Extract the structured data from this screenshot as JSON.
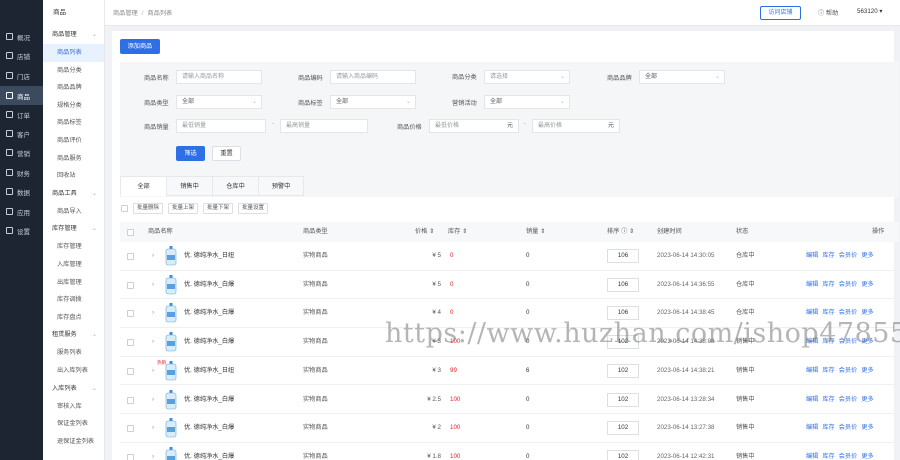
{
  "brand": "",
  "rail": [
    {
      "label": "概况",
      "icon": "overview-icon"
    },
    {
      "label": "店铺",
      "icon": "store-icon"
    },
    {
      "label": "门店",
      "icon": "shop-front-icon"
    },
    {
      "label": "商品",
      "icon": "goods-icon",
      "active": true
    },
    {
      "label": "订单",
      "icon": "order-icon"
    },
    {
      "label": "客户",
      "icon": "customer-icon"
    },
    {
      "label": "营销",
      "icon": "marketing-icon"
    },
    {
      "label": "财务",
      "icon": "finance-icon"
    },
    {
      "label": "数据",
      "icon": "data-icon"
    },
    {
      "label": "应用",
      "icon": "app-icon"
    },
    {
      "label": "设置",
      "icon": "settings-icon"
    }
  ],
  "submenu": {
    "title": "商品",
    "groups": [
      {
        "label": "商品管理",
        "items": [
          "商品列表",
          "商品分类",
          "商品品牌",
          "规格分类",
          "商品标签",
          "商品评价",
          "商品服务",
          "回收站"
        ]
      },
      {
        "label": "商品工具",
        "items": [
          "商品导入"
        ]
      },
      {
        "label": "库存管理",
        "items": [
          "库存管理",
          "入库管理",
          "出库管理",
          "库存调拨",
          "库存盘点"
        ]
      },
      {
        "label": "租赁服务",
        "items": [
          "服务列表",
          "出入库列表"
        ]
      },
      {
        "label": "入库列表",
        "items": [
          "审核入库",
          "保证金列表",
          "退保证金列表"
        ]
      }
    ],
    "active_item": "商品列表"
  },
  "topbar": {
    "breadcrumb": [
      "商品管理",
      "商品列表"
    ],
    "visit_store": "访问店铺",
    "help": "帮助",
    "user": "563120"
  },
  "add_button": "添加商品",
  "filters": {
    "name_label": "商品名称",
    "name_placeholder": "请输入商品名称",
    "code_label": "商品编码",
    "code_placeholder": "请输入商品编码",
    "category_label": "商品分类",
    "category_placeholder": "请选择",
    "brand_label": "商品品牌",
    "brand_value": "全部",
    "type_label": "商品类型",
    "type_value": "全部",
    "tag_label": "商品标签",
    "tag_value": "全部",
    "promo_label": "营销活动",
    "promo_value": "全部",
    "sales_label": "商品销量",
    "sales_min": "最低销量",
    "sales_max": "最高销量",
    "price_label": "商品价格",
    "price_min": "最低价格",
    "price_max": "最高价格",
    "unit": "元",
    "search": "筛选",
    "reset": "重置"
  },
  "tabs": [
    "全部",
    "销售中",
    "仓库中",
    "预警中"
  ],
  "active_tab": "全部",
  "batch_actions": [
    "批量删除",
    "批量上架",
    "批量下架",
    "批量设置"
  ],
  "columns": {
    "name": "商品名称",
    "type": "商品类型",
    "price": "价格",
    "stock": "库存",
    "sales": "销量",
    "sort": "排序",
    "created": "创建时间",
    "status": "状态",
    "ops": "操作"
  },
  "row_actions": [
    "编辑",
    "库存",
    "会员价",
    "更多"
  ],
  "rows": [
    {
      "name": "优. 德纯净水_日纽",
      "type": "实物商品",
      "price": "¥ 5",
      "stock": "0",
      "sales": "0",
      "sort": "106",
      "created": "2023-06-14 14:30:05",
      "status": "仓库中",
      "badge": ""
    },
    {
      "name": "优. 德纯净水_白爆",
      "type": "实物商品",
      "price": "¥ 5",
      "stock": "0",
      "sales": "0",
      "sort": "106",
      "created": "2023-06-14 14:36:55",
      "status": "仓库中",
      "badge": ""
    },
    {
      "name": "优. 德纯净水_白爆",
      "type": "实物商品",
      "price": "¥ 4",
      "stock": "0",
      "sales": "0",
      "sort": "106",
      "created": "2023-06-14 14:38:45",
      "status": "仓库中",
      "badge": ""
    },
    {
      "name": "优. 德纯净水_白爆",
      "type": "实物商品",
      "price": "¥ 3",
      "stock": "100",
      "sales": "0",
      "sort": "102",
      "created": "2023-06-14 14:38:08",
      "status": "销售中",
      "badge": ""
    },
    {
      "name": "优. 德纯净水_日纽",
      "type": "实物商品",
      "price": "¥ 3",
      "stock": "99",
      "sales": "6",
      "sort": "102",
      "created": "2023-06-14 14:38:21",
      "status": "销售中",
      "badge": "热销"
    },
    {
      "name": "优. 德纯净水_白爆",
      "type": "实物商品",
      "price": "¥ 2.5",
      "stock": "100",
      "sales": "0",
      "sort": "102",
      "created": "2023-06-14 13:28:34",
      "status": "销售中",
      "badge": ""
    },
    {
      "name": "优. 德纯净水_白爆",
      "type": "实物商品",
      "price": "¥ 2",
      "stock": "100",
      "sales": "0",
      "sort": "102",
      "created": "2023-06-14 13:27:38",
      "status": "销售中",
      "badge": ""
    },
    {
      "name": "优. 德纯净水_白爆",
      "type": "实物商品",
      "price": "¥ 1.8",
      "stock": "100",
      "sales": "0",
      "sort": "102",
      "created": "2023-06-14 12:42:31",
      "status": "销售中",
      "badge": ""
    }
  ],
  "watermark": "https://www.huzhan.com/ishop47855",
  "colors": {
    "primary": "#2f6fe6",
    "rail": "#1d2533",
    "stock_red": "#e0262b"
  }
}
